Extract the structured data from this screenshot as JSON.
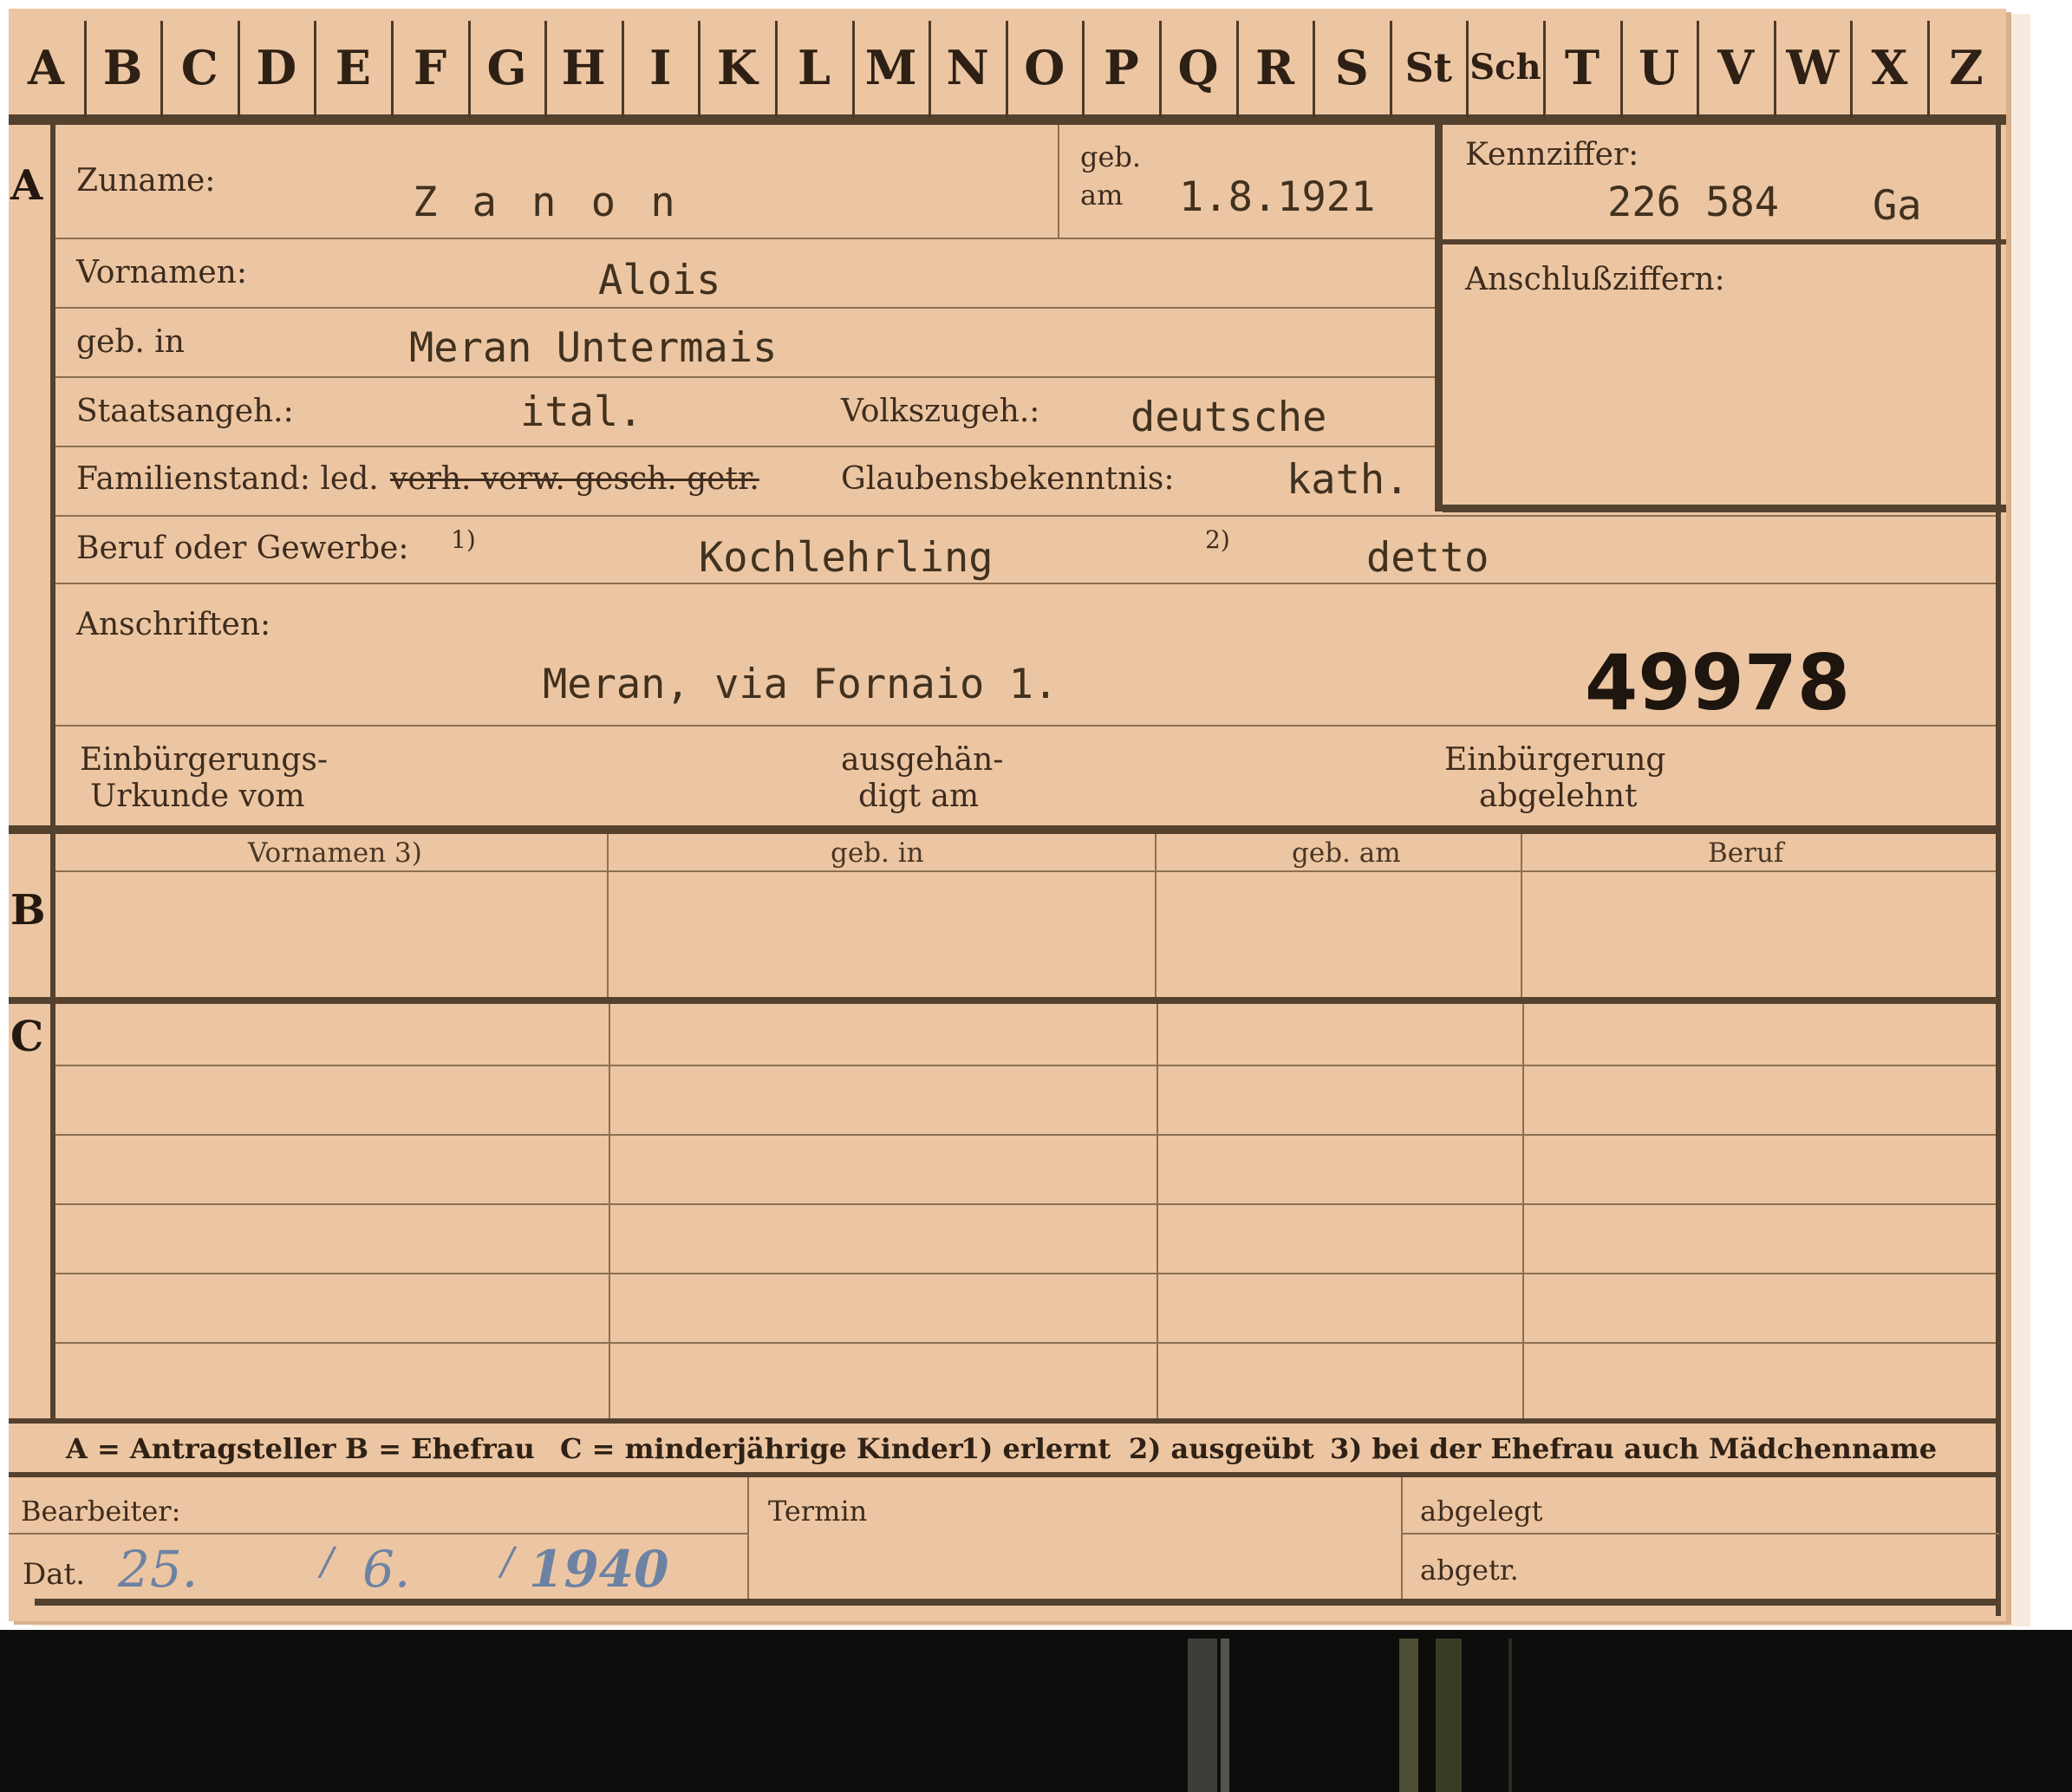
{
  "alphabet_tabs": [
    "A",
    "B",
    "C",
    "D",
    "E",
    "F",
    "G",
    "H",
    "I",
    "K",
    "L",
    "M",
    "N",
    "O",
    "P",
    "Q",
    "R",
    "S",
    "St",
    "Sch",
    "T",
    "U",
    "V",
    "W",
    "X",
    "Z"
  ],
  "row_markers": {
    "a": "A",
    "b": "B",
    "c": "C"
  },
  "section_a": {
    "zuname_label": "Zuname:",
    "zuname_value": "Z a n o n",
    "geb_label_1": "geb.",
    "geb_label_2": "am",
    "geb_am_value": "1.8.1921",
    "kennziffer_label": "Kennziffer:",
    "kennziffer_value": "226 584",
    "kennziffer_suffix": "Ga",
    "anschluss_label": "Anschlußziffern:",
    "vornamen_label": "Vornamen:",
    "vornamen_value": "Alois",
    "geb_in_label": "geb. in",
    "geb_in_value": "Meran Untermais",
    "staatsangeh_label": "Staatsangeh.:",
    "staatsangeh_value": "ital.",
    "volkszugeh_label": "Volkszugeh.:",
    "volkszugeh_value": "deutsche",
    "familienstand_label": "Familienstand: led.",
    "familienstand_struck": "verh. verw. gesch. getr.",
    "glauben_label": "Glaubensbekenntnis:",
    "glauben_value": "kath.",
    "beruf_label": "Beruf oder Gewerbe:",
    "beruf_note1": "1)",
    "beruf_value": "Kochlehrling",
    "beruf_note2": "2)",
    "beruf_value2": "detto",
    "anschriften_label": "Anschriften:",
    "anschriften_value": "Meran, via Fornaio 1.",
    "file_number": "49978",
    "einbuergerung_label_1": "Einbürgerungs-",
    "einbuergerung_label_2": "Urkunde vom",
    "ausgehaendigt_label_1": "ausgehän-",
    "ausgehaendigt_label_2": "digt am",
    "abgelehnt_label_1": "Einbürgerung",
    "abgelehnt_label_2": "abgelehnt"
  },
  "table_headers": [
    "Vornamen 3)",
    "geb. in",
    "geb. am",
    "Beruf"
  ],
  "legend": {
    "a": "A = Antragsteller",
    "b": "B = Ehefrau",
    "c": "C = minderjährige Kinder",
    "n1": "1) erlernt",
    "n2": "2) ausgeübt",
    "n3": "3) bei der Ehefrau auch Mädchenname"
  },
  "footer": {
    "bearbeiter_label": "Bearbeiter:",
    "dat_label": "Dat.",
    "dat_day": "25.",
    "dat_month": "6.",
    "dat_year": "1940",
    "termin_label": "Termin",
    "abgelegt_label": "abgelegt",
    "abgetr_label": "abgetr."
  },
  "colors": {
    "card": "#ecc6a2",
    "ink": "#3a2a1c",
    "handwriting": "#6d82a3",
    "background": "#0d0d0b"
  }
}
